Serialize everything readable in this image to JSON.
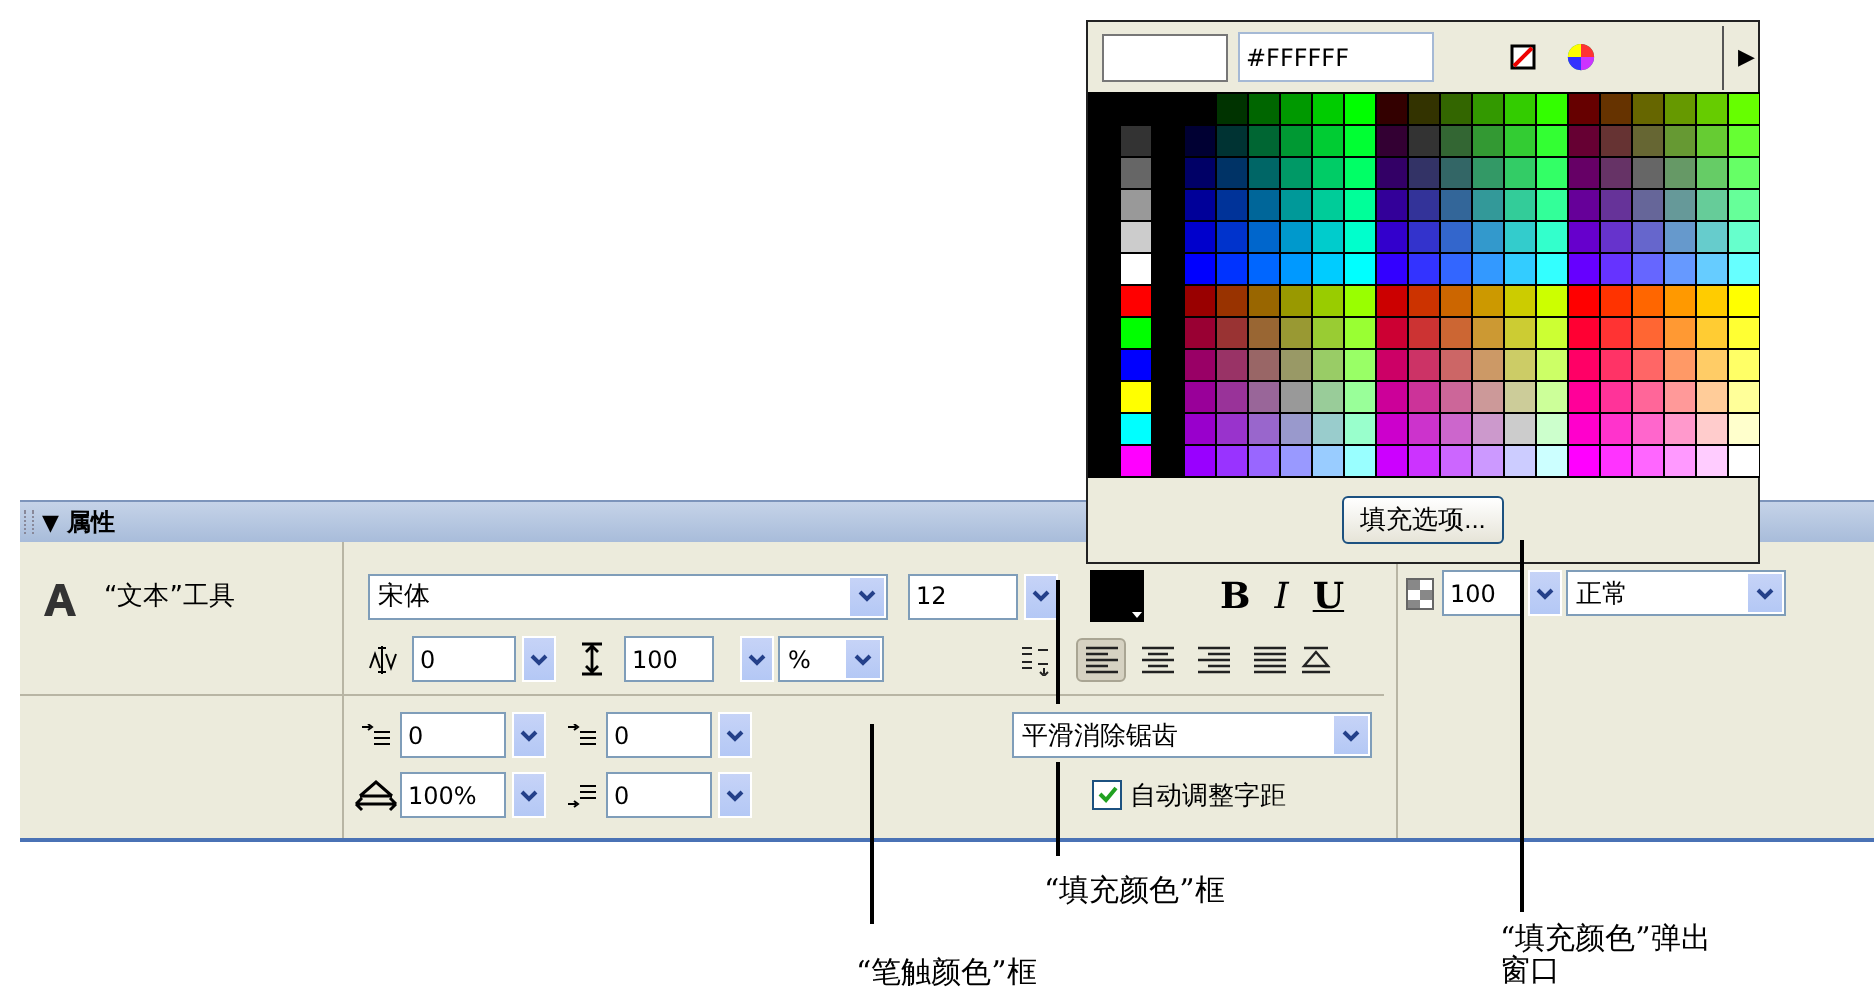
{
  "color_popup": {
    "hex_value": "#FFFFFF",
    "menu_glyph": "▶",
    "fill_options_button": "填充选项..."
  },
  "properties_panel": {
    "collapse_glyph": "▼",
    "title": "属性",
    "tool_name": "“文本”工具",
    "font_family": "宋体",
    "font_size": "12",
    "style_buttons": [
      {
        "kind": "bold",
        "label": "B"
      },
      {
        "kind": "italic",
        "label": "I"
      },
      {
        "kind": "underline",
        "label": "U"
      }
    ],
    "letter_spacing": "0",
    "line_spacing": "100",
    "spacing_unit": "%",
    "alignments": [
      {
        "kind": "left",
        "selected": true
      },
      {
        "kind": "center",
        "selected": false
      },
      {
        "kind": "right",
        "selected": false
      },
      {
        "kind": "justify",
        "selected": false
      }
    ],
    "paragraph_fields": [
      {
        "kind": "indent",
        "value": "0"
      },
      {
        "kind": "line-gap",
        "value": "0"
      },
      {
        "kind": "width",
        "value": "100%"
      },
      {
        "kind": "margin",
        "value": "0"
      }
    ],
    "antialias": "平滑消除锯齿",
    "auto_kern": {
      "label": "自动调整字距",
      "checked": true
    },
    "alpha": "100",
    "blend_mode": "正常"
  },
  "annotations": [
    {
      "text": "“填充颜色”框"
    },
    {
      "text": "“笔触颜色”框"
    },
    {
      "text": "“填充颜色”弹出窗口"
    }
  ]
}
